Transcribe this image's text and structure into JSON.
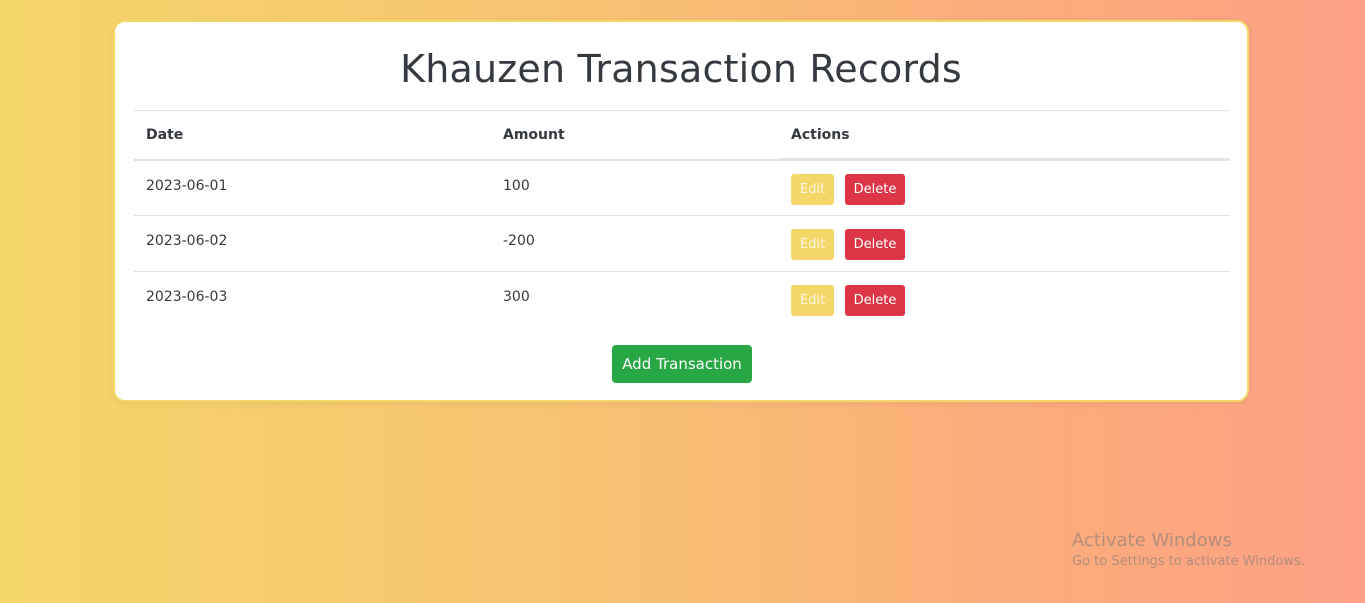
{
  "page": {
    "title": "Khauzen Transaction Records"
  },
  "table": {
    "headers": {
      "date": "Date",
      "amount": "Amount",
      "actions": "Actions"
    },
    "rows": [
      {
        "date": "2023-06-01",
        "amount": "100",
        "edit_label": "Edit",
        "delete_label": "Delete"
      },
      {
        "date": "2023-06-02",
        "amount": "-200",
        "edit_label": "Edit",
        "delete_label": "Delete"
      },
      {
        "date": "2023-06-03",
        "amount": "300",
        "edit_label": "Edit",
        "delete_label": "Delete"
      }
    ]
  },
  "add_button_label": "Add Transaction",
  "watermark": {
    "title": "Activate Windows",
    "subtitle": "Go to Settings to activate Windows."
  },
  "colors": {
    "edit": "#f5d669",
    "delete": "#dc3545",
    "add": "#28a745",
    "background_start": "#f5d669",
    "background_end": "#fda085"
  }
}
